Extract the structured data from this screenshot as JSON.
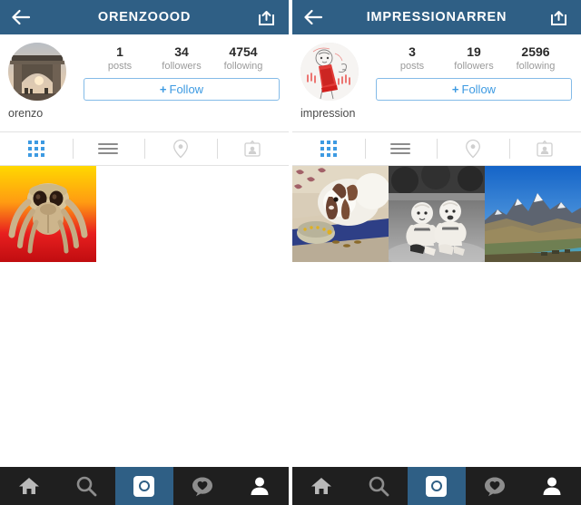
{
  "panels": [
    {
      "header": {
        "title": "ORENZOOOD",
        "back_icon": "back-arrow-icon",
        "share_icon": "share-icon"
      },
      "profile": {
        "username": "orenzo",
        "avatar_alt": "stone-arch-sunset-avatar",
        "stats": [
          {
            "value": "1",
            "label": "posts"
          },
          {
            "value": "34",
            "label": "followers"
          },
          {
            "value": "4754",
            "label": "following"
          }
        ],
        "follow_button": {
          "plus": "+",
          "label": "Follow"
        }
      },
      "tabs": [
        {
          "name": "grid",
          "icon": "grid-dots-icon",
          "active": true
        },
        {
          "name": "list",
          "icon": "list-bars-icon",
          "active": false
        },
        {
          "name": "map",
          "icon": "location-pin-icon",
          "active": false
        },
        {
          "name": "tagged",
          "icon": "photos-of-you-icon",
          "active": false
        }
      ],
      "photos": [
        {
          "alt": "jumping-spider-macro-yellow-red"
        }
      ]
    },
    {
      "header": {
        "title": "IMPRESSIONARREN",
        "back_icon": "back-arrow-icon",
        "share_icon": "share-icon"
      },
      "profile": {
        "username": "impression",
        "avatar_alt": "red-white-line-art-sketch-avatar",
        "stats": [
          {
            "value": "3",
            "label": "posts"
          },
          {
            "value": "19",
            "label": "followers"
          },
          {
            "value": "2596",
            "label": "following"
          }
        ],
        "follow_button": {
          "plus": "+",
          "label": "Follow"
        }
      },
      "tabs": [
        {
          "name": "grid",
          "icon": "grid-dots-icon",
          "active": true
        },
        {
          "name": "list",
          "icon": "list-bars-icon",
          "active": false
        },
        {
          "name": "map",
          "icon": "location-pin-icon",
          "active": false
        },
        {
          "name": "tagged",
          "icon": "photos-of-you-icon",
          "active": false
        }
      ],
      "photos": [
        {
          "alt": "rabbit-on-patterned-carpet"
        },
        {
          "alt": "black-and-white-twin-babies-on-grass"
        },
        {
          "alt": "mountain-landscape-blue-sky"
        }
      ]
    }
  ],
  "tabbar": {
    "items": [
      {
        "name": "home",
        "icon": "home-icon",
        "active": false
      },
      {
        "name": "search",
        "icon": "search-icon",
        "active": false
      },
      {
        "name": "camera",
        "icon": "camera-icon",
        "active": true
      },
      {
        "name": "activity",
        "icon": "heart-bubble-icon",
        "active": false
      },
      {
        "name": "profile",
        "icon": "person-icon",
        "active": true
      }
    ]
  },
  "colors": {
    "header_blue": "#2f5f85",
    "accent_blue": "#3d9ae2",
    "follow_border": "#84bbe8",
    "tabbar_dark": "#1f1f1f",
    "muted_text": "#9a9a9a"
  }
}
